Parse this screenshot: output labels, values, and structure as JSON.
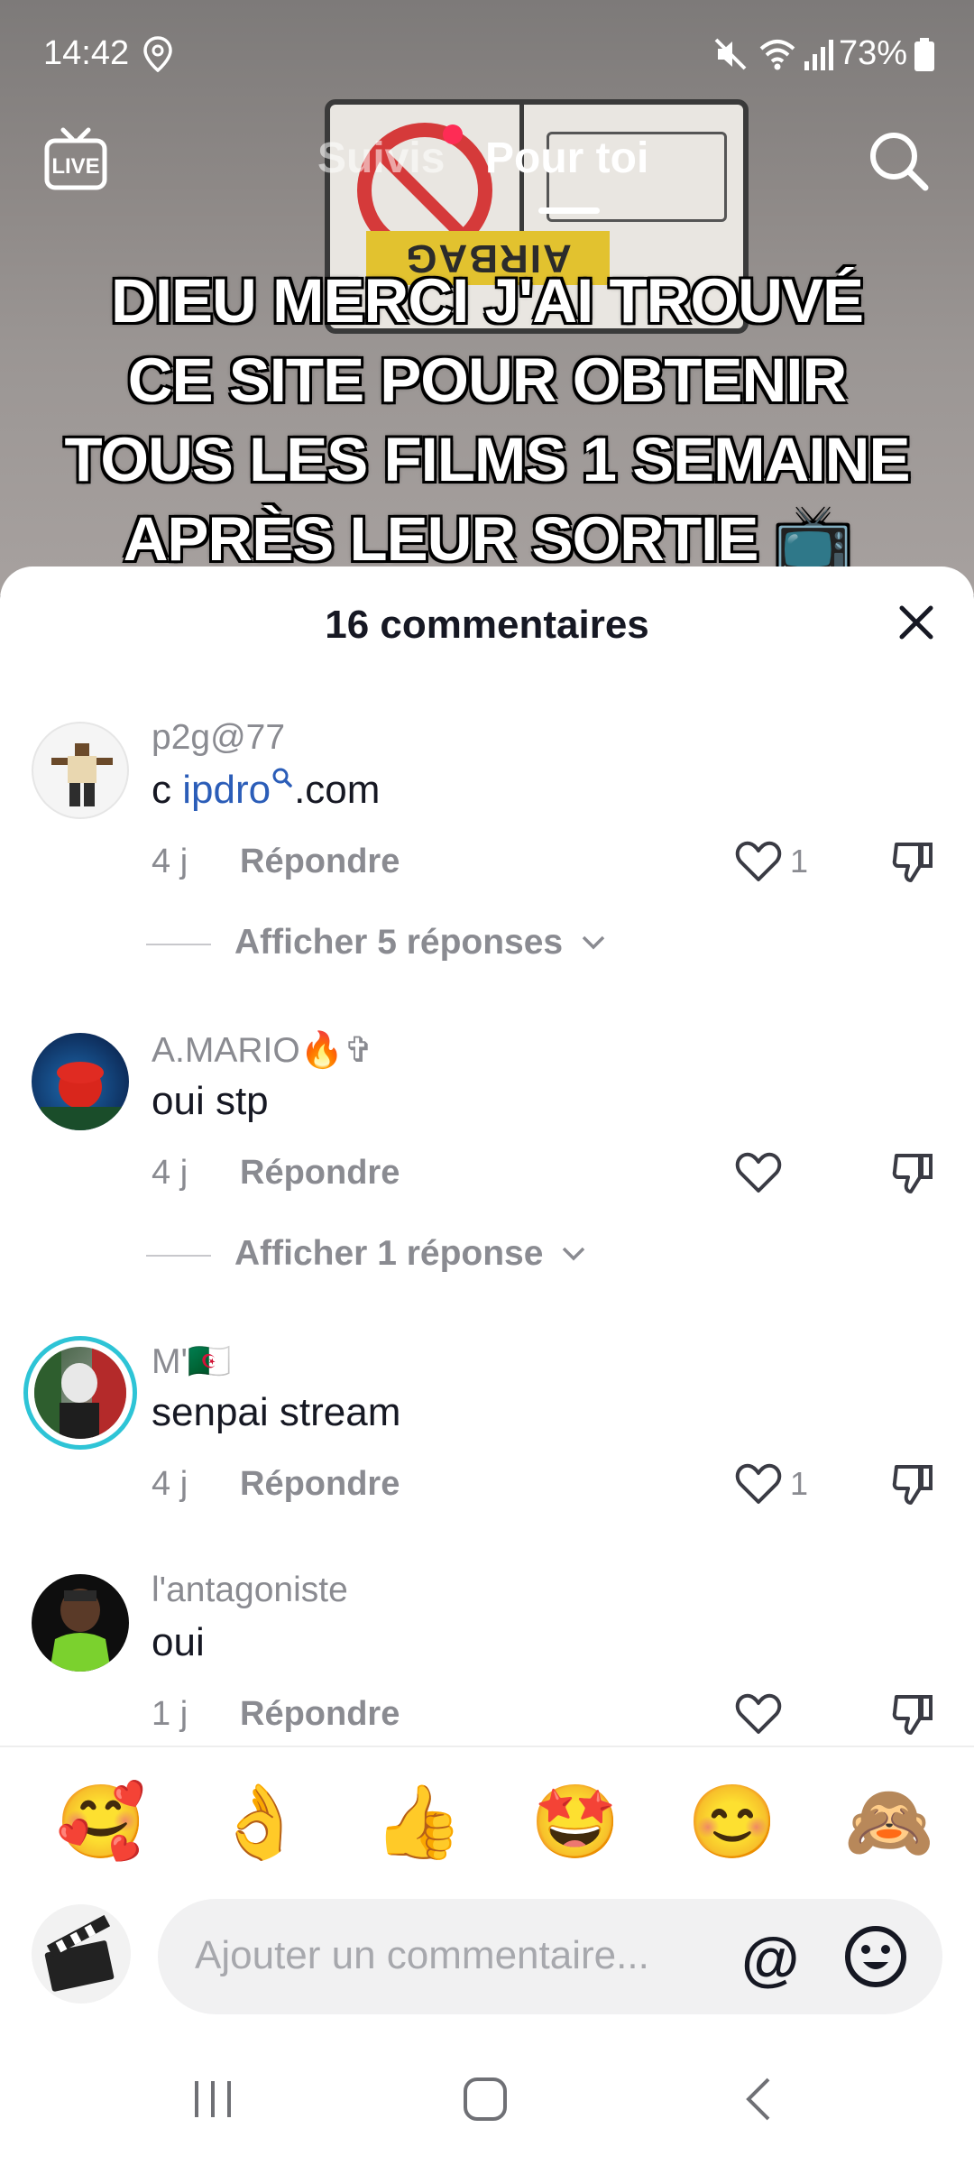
{
  "status_bar": {
    "time": "14:42",
    "battery_percent": "73%",
    "icons": [
      "location-icon",
      "mute-icon",
      "wifi-icon",
      "signal-icon",
      "battery-icon"
    ]
  },
  "top_nav": {
    "live_label": "LIVE",
    "tabs": [
      {
        "label": "Suivis",
        "active": false,
        "has_dot": true
      },
      {
        "label": "Pour toi",
        "active": true
      }
    ],
    "search_icon": "search-icon"
  },
  "video": {
    "sign_text": "AIRBAG",
    "caption_lines": [
      "DIEU MERCI J'AI TROUVÉ",
      "CE SITE POUR OBTENIR",
      "TOUS LES FILMS 1 SEMAINE",
      "APRÈS LEUR SORTIE 📺"
    ]
  },
  "comments_sheet": {
    "title": "16 commentaires",
    "close_icon": "close-icon",
    "comments": [
      {
        "username": "p2g@77",
        "text_prefix": "c ",
        "text_link": "ipdro",
        "text_suffix": ".com",
        "time": "4 j",
        "reply_label": "Répondre",
        "likes": "1",
        "view_replies": "Afficher 5 réponses"
      },
      {
        "username": "A.MARIO🔥✞",
        "text": "oui stp",
        "time": "4 j",
        "reply_label": "Répondre",
        "likes": "",
        "view_replies": "Afficher 1 réponse"
      },
      {
        "username": "M'🇩🇿",
        "text": "senpai stream",
        "time": "4 j",
        "reply_label": "Répondre",
        "likes": "1"
      },
      {
        "username": "l'antagoniste",
        "text": "oui",
        "time": "1 j",
        "reply_label": "Répondre",
        "likes": ""
      }
    ]
  },
  "emoji_bar": {
    "emojis": [
      "🥰",
      "👌",
      "👍",
      "🤩",
      "😊",
      "🙈"
    ]
  },
  "input_bar": {
    "placeholder": "Ajouter un commentaire...",
    "mention_label": "@"
  },
  "android_nav": {
    "icons": [
      "recents-icon",
      "home-icon",
      "back-icon"
    ]
  },
  "colors": {
    "accent_red": "#fe2c55",
    "link_blue": "#2b5db8",
    "text_primary": "#161823",
    "text_secondary": "#8a8b91"
  }
}
